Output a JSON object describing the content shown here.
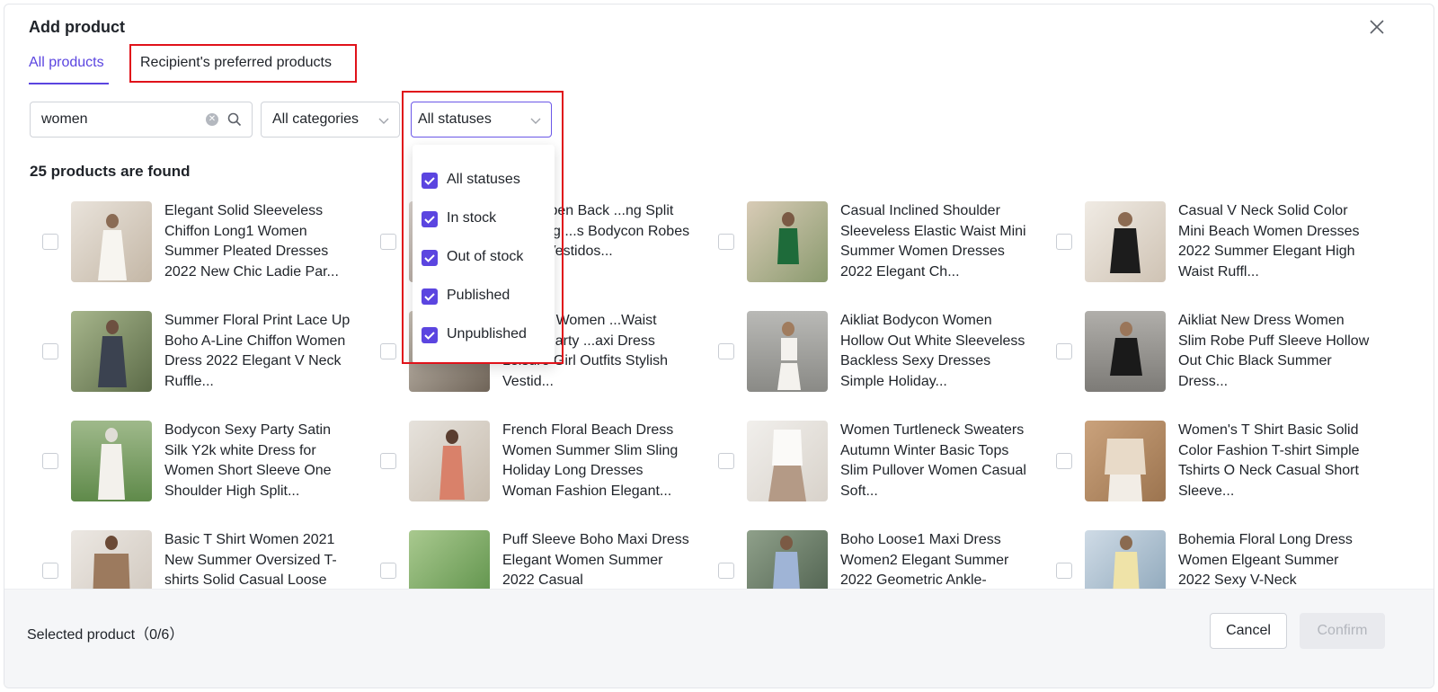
{
  "dialog": {
    "title": "Add product"
  },
  "tabs": [
    {
      "label": "All products",
      "active": true
    },
    {
      "label": "Recipient's preferred products",
      "active": false
    }
  ],
  "filters": {
    "search_value": "women",
    "category_label": "All categories",
    "status_label": "All statuses"
  },
  "status_dropdown": {
    "options": [
      {
        "label": "All statuses",
        "checked": true
      },
      {
        "label": "In stock",
        "checked": true
      },
      {
        "label": "Out of stock",
        "checked": true
      },
      {
        "label": "Published",
        "checked": true
      },
      {
        "label": "Unpublished",
        "checked": true
      }
    ]
  },
  "results": {
    "found_text": "25 products are found"
  },
  "products": [
    {
      "name": "Elegant Solid Sleeveless Chiffon Long1 Women Summer Pleated Dresses 2022 New Chic Ladie Par..."
    },
    {
      "name": "Sexy Open Back ...ng Split Skirt Bag ...s Bodycon Robes ...men Vestidos..."
    },
    {
      "name": "Casual Inclined Shoulder Sleeveless Elastic Waist Mini Summer Women Dresses 2022 Elegant Ch..."
    },
    {
      "name": "Casual V Neck Solid Color Mini Beach Women Dresses 2022 Summer Elegant High Waist Ruffl..."
    },
    {
      "name": "Summer Floral Print Lace Up Boho A-Line Chiffon Women Dress 2022 Elegant V Neck Ruffle..."
    },
    {
      "name": "...Dress Women ...Waist Loose Party ...axi Dress Leisure Girl Outfits Stylish Vestid..."
    },
    {
      "name": "Aikliat Bodycon Women Hollow Out White Sleeveless Backless Sexy Dresses Simple Holiday..."
    },
    {
      "name": "Aikliat New Dress Women Slim Robe Puff Sleeve Hollow Out Chic Black Summer Dress..."
    },
    {
      "name": "Bodycon Sexy Party Satin Silk Y2k white Dress for Women Short Sleeve One Shoulder High Split..."
    },
    {
      "name": "French Floral Beach Dress Women Summer Slim Sling Holiday Long Dresses Woman Fashion Elegant..."
    },
    {
      "name": "Women Turtleneck Sweaters Autumn Winter Basic Tops Slim Pullover Women Casual Soft..."
    },
    {
      "name": "Women's T Shirt Basic Solid Color Fashion T-shirt Simple Tshirts O Neck Casual Short Sleeve..."
    },
    {
      "name": "Basic T Shirt Women 2021 New Summer Oversized T-shirts Solid Casual Loose"
    },
    {
      "name": "Puff Sleeve Boho Maxi Dress Elegant Women Summer 2022 Casual"
    },
    {
      "name": "Boho Loose1 Maxi Dress Women2 Elegant Summer 2022 Geometric Ankle-"
    },
    {
      "name": "Bohemia Floral Long Dress Women Elgeant Summer 2022 Sexy V-Neck"
    }
  ],
  "footer": {
    "selected_text": "Selected product（0/6）",
    "cancel_label": "Cancel",
    "confirm_label": "Confirm"
  },
  "colors": {
    "accent": "#5b45e0",
    "highlight": "#e0121a"
  }
}
